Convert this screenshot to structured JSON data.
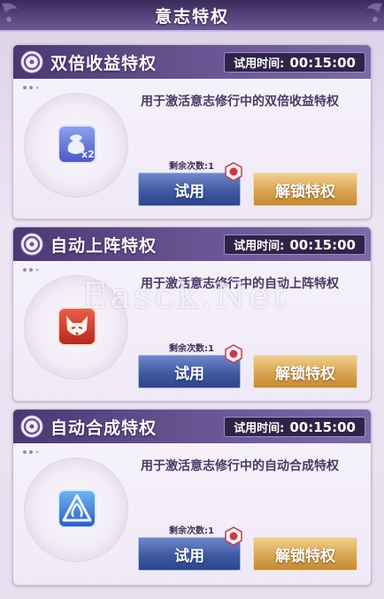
{
  "header": {
    "title": "意志特权"
  },
  "cards": [
    {
      "name": "双倍收益特权",
      "trial_label": "试用时间:",
      "trial_time": "00:15:00",
      "description": "用于激活意志修行中的双倍收益特权",
      "remaining": "剩余次数:1",
      "try_label": "试用",
      "unlock_label": "解锁特权",
      "icon": "double-reward-icon"
    },
    {
      "name": "自动上阵特权",
      "trial_label": "试用时间:",
      "trial_time": "00:15:00",
      "description": "用于激活意志修行中的自动上阵特权",
      "remaining": "剩余次数:1",
      "try_label": "试用",
      "unlock_label": "解锁特权",
      "icon": "fox-mask-icon"
    },
    {
      "name": "自动合成特权",
      "trial_label": "试用时间:",
      "trial_time": "00:15:00",
      "description": "用于激活意志修行中的自动合成特权",
      "remaining": "剩余次数:1",
      "try_label": "试用",
      "unlock_label": "解锁特权",
      "icon": "auto-combine-icon"
    }
  ],
  "watermark": "Easck.Net",
  "colors": {
    "header_purple": "#4b3872",
    "try_blue": "#3e5aa3",
    "unlock_gold": "#d9a551"
  }
}
